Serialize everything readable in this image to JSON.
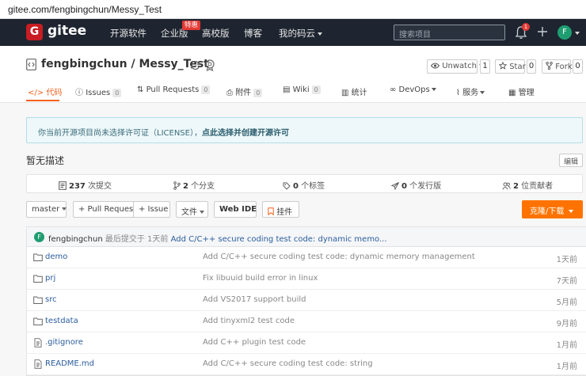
{
  "browser": {
    "url": "gitee.com/fengbingchun/Messy_Test"
  },
  "nav": {
    "logo_text": "gitee",
    "items": [
      {
        "label": "开源软件"
      },
      {
        "label": "企业版"
      },
      {
        "label": "高校版"
      },
      {
        "label": "博客"
      },
      {
        "label": "我的码云"
      }
    ],
    "enterprise_badge": "特惠",
    "search_placeholder": "搜索项目",
    "notification_count": "1",
    "avatar_letter": "F"
  },
  "repo": {
    "title": "fengbingchun / Messy_Test",
    "unwatch": {
      "label": "Unwatch",
      "count": "1"
    },
    "star": {
      "label": "Star",
      "count": "0"
    },
    "fork": {
      "label": "Fork",
      "count": "0"
    }
  },
  "tabs": [
    {
      "label": "代码"
    },
    {
      "label": "Issues",
      "count": "0"
    },
    {
      "label": "Pull Requests",
      "count": "0"
    },
    {
      "label": "附件",
      "count": "0"
    },
    {
      "label": "Wiki",
      "count": "0"
    },
    {
      "label": "统计"
    },
    {
      "label": "DevOps"
    },
    {
      "label": "服务"
    },
    {
      "label": "管理"
    }
  ],
  "notice": {
    "text": "你当前开源项目尚未选择许可证（LICENSE），",
    "link": "点此选择并创建开源许可"
  },
  "description": {
    "text": "暂无描述",
    "edit_label": "编辑"
  },
  "stats": {
    "commits": {
      "count": "237",
      "label": "次提交"
    },
    "branches": {
      "count": "2",
      "label": "个分支"
    },
    "tags": {
      "count": "0",
      "label": "个标签"
    },
    "releases": {
      "count": "0",
      "label": "个发行版"
    },
    "contributors": {
      "count": "2",
      "label": "位贡献者"
    }
  },
  "actions": {
    "branch": "master",
    "pull_request": "+ Pull Request",
    "issue": "+ Issue",
    "file": "文件",
    "web_ide": "Web IDE",
    "mount": "挂件",
    "clone": "克隆/下载"
  },
  "latest_commit": {
    "avatar_letter": "F",
    "author": "fengbingchun",
    "meta": "最后提交于 1天前",
    "message": "Add C/C++ secure coding test code: dynamic memo..."
  },
  "files": [
    {
      "type": "folder",
      "name": "demo",
      "message": "Add C/C++ secure coding test code: dynamic memory management",
      "time": "1天前"
    },
    {
      "type": "folder",
      "name": "prj",
      "message": "Fix libuuid build error in linux",
      "time": "7天前"
    },
    {
      "type": "folder",
      "name": "src",
      "message": "Add VS2017 support build",
      "time": "5月前"
    },
    {
      "type": "folder",
      "name": "testdata",
      "message": "Add tinyxml2 test code",
      "time": "9月前"
    },
    {
      "type": "file",
      "name": ".gitignore",
      "message": "Add C++ plugin test code",
      "time": "1月前"
    },
    {
      "type": "file",
      "name": "README.md",
      "message": "Add C/C++ secure coding test code: string",
      "time": "1月前"
    }
  ]
}
